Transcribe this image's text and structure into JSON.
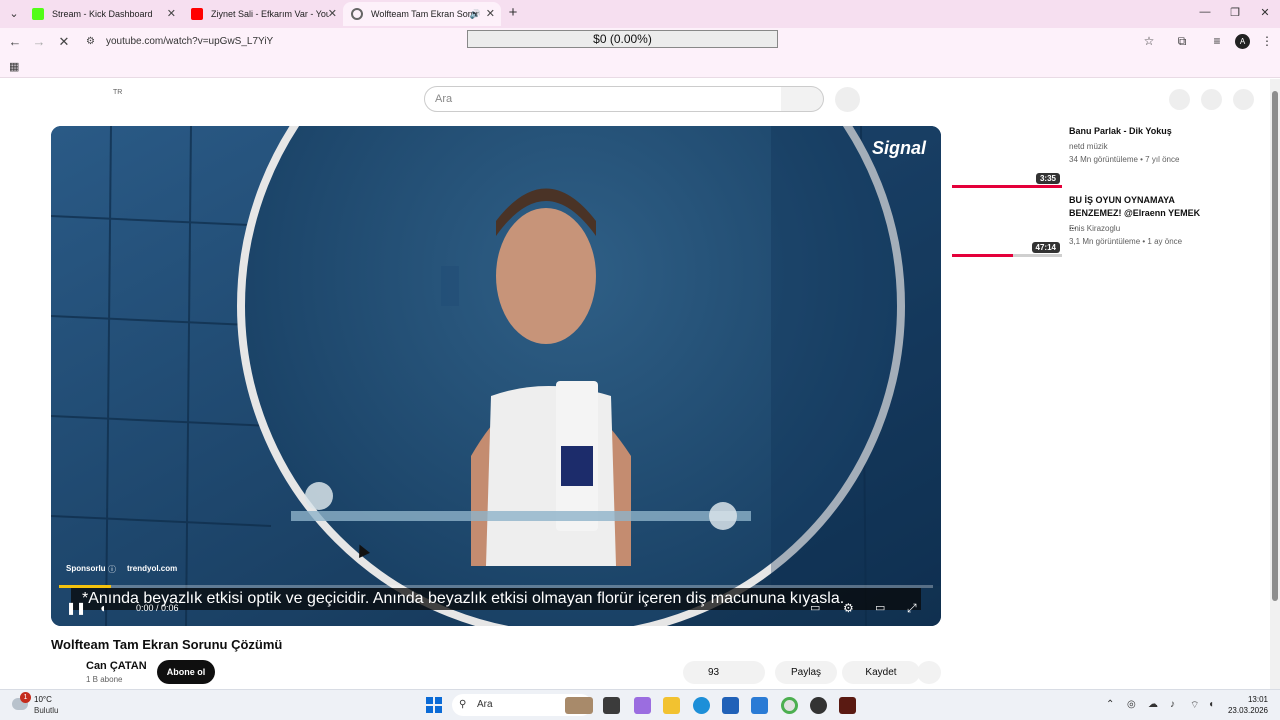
{
  "browser": {
    "tabs": [
      {
        "title": "Stream - Kick Dashboard",
        "favicon_color": "#53fc18"
      },
      {
        "title": "Ziynet Sali - Efkarım Var - YouTu",
        "favicon_color": "#ff0000"
      },
      {
        "title": "Wolfteam Tam Ekran Sorunu",
        "favicon_color": "#666666"
      }
    ],
    "url": "youtube.com/watch?v=upGwS_L7YiY",
    "profile_initial": "A"
  },
  "overlay": {
    "value": "$0 (0.00%)"
  },
  "youtube": {
    "country_code": "TR",
    "search_placeholder": "Ara",
    "video": {
      "brand": "Signal",
      "sponsor_label": "Sponsorlu",
      "sponsor_info_icon": "ⓘ",
      "sponsor_site": "trendyol.com",
      "caption": "*Anında beyazlık etkisi optik ve geçicidir. Anında beyazlık etkisi olmayan florür içeren diş macununa kıyasla.",
      "timecode": "0:00 / 0:06",
      "ad_progress": 0.06
    },
    "title": "Wolfteam Tam Ekran Sorunu Çözümü",
    "channel": "Can ÇATAN",
    "subscribers": "1 B abone",
    "subscribe_label": "Abone ol",
    "likes": "93",
    "share_label": "Paylaş",
    "save_label": "Kaydet",
    "recommendations": [
      {
        "title": "Banu Parlak - Dik Yokuş",
        "channel": "netd müzik",
        "meta": "34 Mn görüntüleme • 7 yıl önce",
        "duration": "3:35",
        "watched": 1.0
      },
      {
        "title": "BU İŞ OYUN OYNAMAYA BENZEMEZ! @Elraenn YEMEK ...",
        "channel": "Enis Kirazoglu",
        "meta": "3,1 Mn görüntüleme • 1 ay önce",
        "duration": "47:14",
        "watched": 0.55
      }
    ]
  },
  "taskbar": {
    "temperature": "10°C",
    "weather": "Bulutlu",
    "weather_badge": "1",
    "search_placeholder": "Ara",
    "time": "13:01",
    "date": "23.03.2026"
  }
}
